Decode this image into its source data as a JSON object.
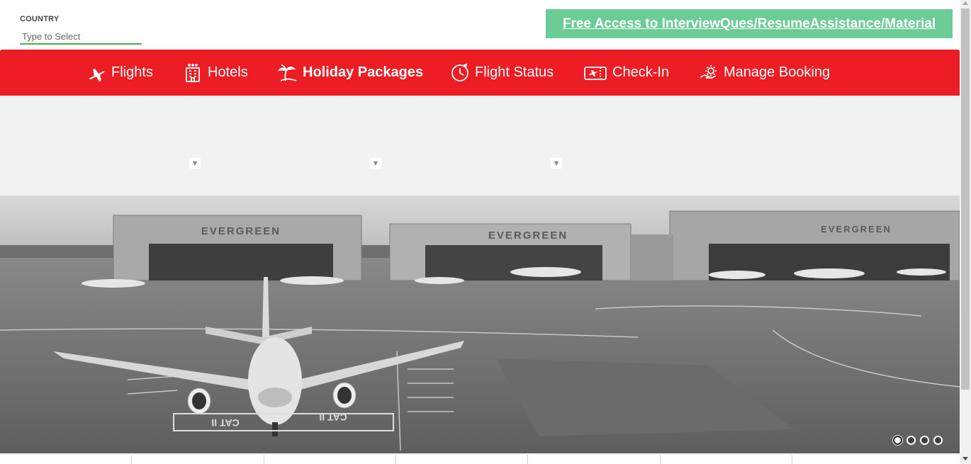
{
  "country": {
    "label": "COUNTRY",
    "placeholder": "Type to Select",
    "value": ""
  },
  "promo": {
    "text": "Free Access to InterviewQues/ResumeAssistance/Material",
    "background": "#6ccc96"
  },
  "nav": {
    "background": "#ec1d24",
    "items": [
      {
        "label": "Flights",
        "icon": "airplane-icon",
        "active": false
      },
      {
        "label": "Hotels",
        "icon": "hotel-building-icon",
        "active": false
      },
      {
        "label": "Holiday Packages",
        "icon": "palm-tree-island-icon",
        "active": true
      },
      {
        "label": "Flight Status",
        "icon": "clock-status-icon",
        "active": false
      },
      {
        "label": "Check-In",
        "icon": "boarding-pass-icon",
        "active": false
      },
      {
        "label": "Manage Booking",
        "icon": "gear-hand-icon",
        "active": false
      }
    ]
  },
  "search_panel": {
    "dropdown_arrows": [
      "▼",
      "▼",
      "▼"
    ]
  },
  "hero": {
    "signage": [
      "EVERGREEN",
      "EVERGREEN",
      "EVERGREEN"
    ],
    "runway_markings": [
      "CAT II",
      "CAT II"
    ],
    "carousel": {
      "total": 4,
      "active": 1
    }
  }
}
